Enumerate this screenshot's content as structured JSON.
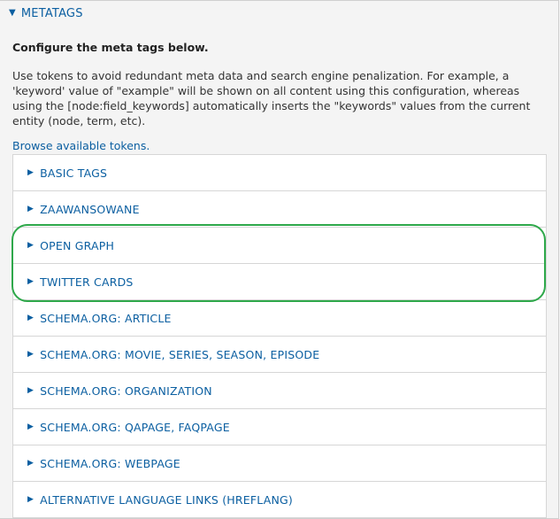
{
  "metatags": {
    "summary_label": "METATAGS",
    "configure_title": "Configure the meta tags below.",
    "description": "Use tokens to avoid redundant meta data and search engine penalization. For example, a 'keyword' value of \"example\" will be shown on all content using this configuration, whereas using the [node:field_keywords] automatically inserts the \"keywords\" values from the current entity (node, term, etc).",
    "browse_link": "Browse available tokens."
  },
  "groups": [
    {
      "label": "BASIC TAGS"
    },
    {
      "label": "ZAAWANSOWANE"
    },
    {
      "label": "OPEN GRAPH"
    },
    {
      "label": "TWITTER CARDS"
    },
    {
      "label": "SCHEMA.ORG: ARTICLE"
    },
    {
      "label": "SCHEMA.ORG: MOVIE, SERIES, SEASON, EPISODE"
    },
    {
      "label": "SCHEMA.ORG: ORGANIZATION"
    },
    {
      "label": "SCHEMA.ORG: QAPAGE, FAQPAGE"
    },
    {
      "label": "SCHEMA.ORG: WEBPAGE"
    },
    {
      "label": "ALTERNATIVE LANGUAGE LINKS (HREFLANG)"
    }
  ],
  "colors": {
    "link": "#0b5fa1",
    "highlight": "#2ea84a"
  }
}
